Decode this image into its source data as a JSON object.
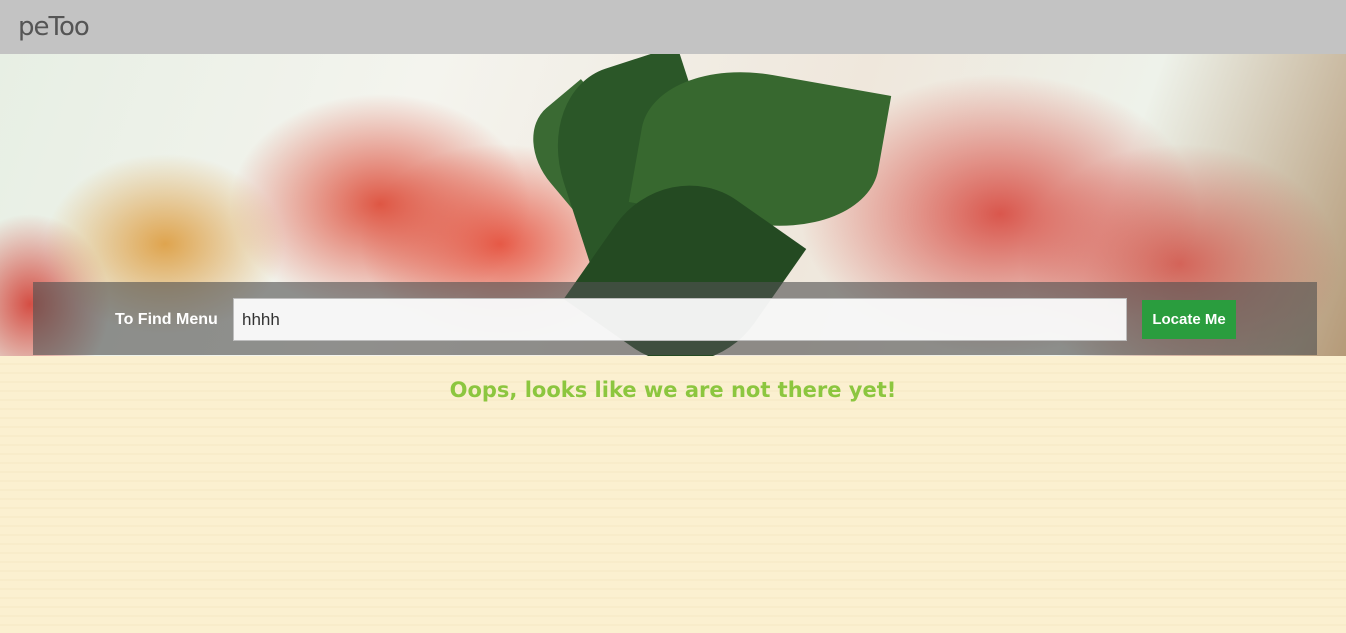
{
  "header": {
    "logo_text": "peToo"
  },
  "search": {
    "label": "To Find Menu",
    "value": "hhhh",
    "button_label": "Locate Me"
  },
  "main": {
    "message": "Oops, looks like we are not there yet!"
  },
  "colors": {
    "topbar": "#c3c3c3",
    "button": "#2a9d3e",
    "message": "#8cc63f",
    "background": "#fbf0d0"
  }
}
